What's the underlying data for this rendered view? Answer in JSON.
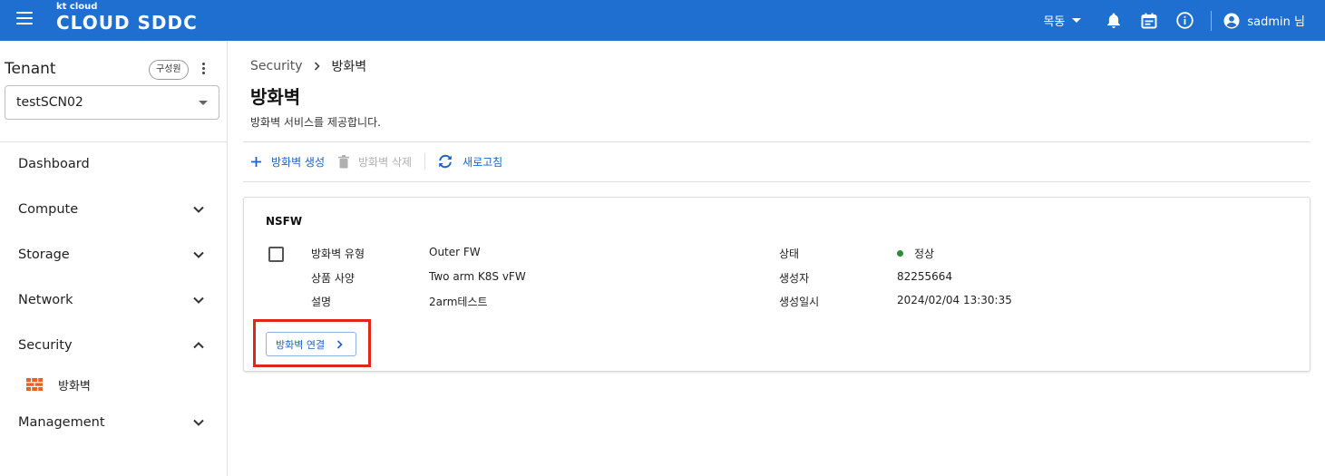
{
  "header": {
    "logo_small": "kt cloud",
    "logo_main": "CLOUD SDDC",
    "region": "목동",
    "user_name": "sadmin 님"
  },
  "sidebar": {
    "tenant_label": "Tenant",
    "member_button": "구성원",
    "tenant_selected": "testSCN02",
    "items": [
      {
        "label": "Dashboard"
      },
      {
        "label": "Compute"
      },
      {
        "label": "Storage"
      },
      {
        "label": "Network"
      },
      {
        "label": "Security"
      },
      {
        "label": "Management"
      }
    ],
    "security_sub": {
      "label": "방화벽",
      "icon": "firewall-icon"
    }
  },
  "breadcrumb": {
    "parent": "Security",
    "current": "방화벽"
  },
  "page": {
    "title": "방화벽",
    "description": "방화벽 서비스를 제공합니다."
  },
  "toolbar": {
    "create_label": "방화벽 생성",
    "delete_label": "방화벽 삭제",
    "refresh_label": "새로고침"
  },
  "card": {
    "title": "NSFW",
    "fields_left": [
      {
        "key": "방화벽 유형",
        "value": "Outer FW"
      },
      {
        "key": "상품 사양",
        "value": "Two arm K8S vFW"
      },
      {
        "key": "설명",
        "value": "2arm테스트"
      }
    ],
    "fields_right": [
      {
        "key": "상태",
        "value": "정상"
      },
      {
        "key": "생성자",
        "value": "82255664"
      },
      {
        "key": "생성일시",
        "value": "2024/02/04 13:30:35"
      }
    ],
    "connect_button": "방화벽 연결"
  },
  "colors": {
    "header_bg": "#1e6fd0",
    "accent": "#1e62c4",
    "status_ok": "#2e8b3a",
    "highlight": "#e1261c"
  }
}
